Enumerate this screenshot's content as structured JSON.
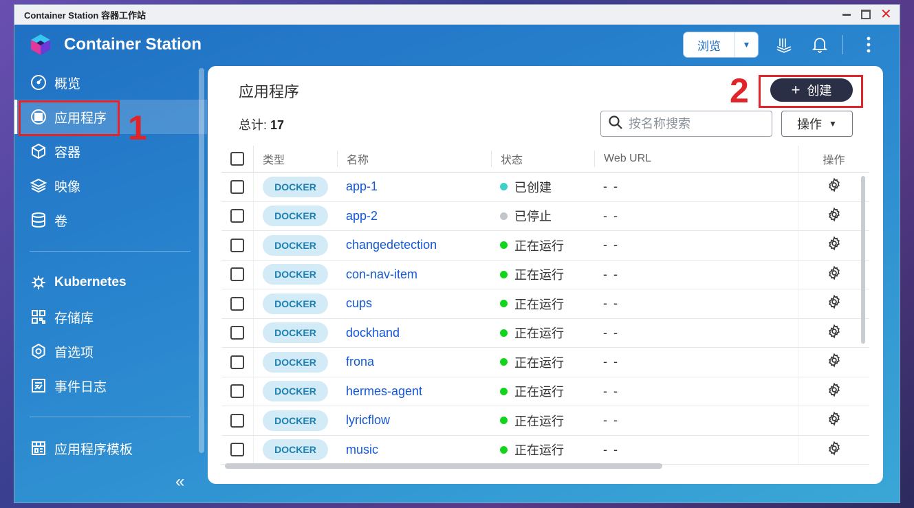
{
  "window": {
    "title": "Container Station 容器工作站"
  },
  "header": {
    "app_name": "Container Station",
    "browse_label": "浏览"
  },
  "sidebar": {
    "items": [
      {
        "label": "概览",
        "icon": "dashboard-icon"
      },
      {
        "label": "应用程序",
        "icon": "apps-grid-icon",
        "active": true
      },
      {
        "label": "容器",
        "icon": "cube-icon"
      },
      {
        "label": "映像",
        "icon": "layers-icon"
      },
      {
        "label": "卷",
        "icon": "database-icon"
      }
    ],
    "items2": [
      {
        "label": "Kubernetes",
        "icon": "helm-wheel-icon"
      },
      {
        "label": "存储库",
        "icon": "registry-icon"
      },
      {
        "label": "首选项",
        "icon": "settings-gear-icon"
      },
      {
        "label": "事件日志",
        "icon": "event-log-icon"
      }
    ],
    "items3": [
      {
        "label": "应用程序模板",
        "icon": "template-icon"
      }
    ],
    "collapse_glyph": "«"
  },
  "main": {
    "title": "应用程序",
    "total_label": "总计:",
    "total_value": "17",
    "create_label": "创建",
    "search_placeholder": "按名称搜索",
    "ops_label": "操作",
    "columns": {
      "type": "类型",
      "name": "名称",
      "status": "状态",
      "url": "Web URL",
      "action": "操作"
    },
    "rows": [
      {
        "type": "DOCKER",
        "name": "app-1",
        "status": "已创建",
        "status_color": "#3bd0c8",
        "url": "- -"
      },
      {
        "type": "DOCKER",
        "name": "app-2",
        "status": "已停止",
        "status_color": "#c2c5c9",
        "url": "- -"
      },
      {
        "type": "DOCKER",
        "name": "changedetection",
        "status": "正在运行",
        "status_color": "#12d41b",
        "url": "- -"
      },
      {
        "type": "DOCKER",
        "name": "con-nav-item",
        "status": "正在运行",
        "status_color": "#12d41b",
        "url": "- -"
      },
      {
        "type": "DOCKER",
        "name": "cups",
        "status": "正在运行",
        "status_color": "#12d41b",
        "url": "- -"
      },
      {
        "type": "DOCKER",
        "name": "dockhand",
        "status": "正在运行",
        "status_color": "#12d41b",
        "url": "- -"
      },
      {
        "type": "DOCKER",
        "name": "frona",
        "status": "正在运行",
        "status_color": "#12d41b",
        "url": "- -"
      },
      {
        "type": "DOCKER",
        "name": "hermes-agent",
        "status": "正在运行",
        "status_color": "#12d41b",
        "url": "- -"
      },
      {
        "type": "DOCKER",
        "name": "lyricflow",
        "status": "正在运行",
        "status_color": "#12d41b",
        "url": "- -"
      },
      {
        "type": "DOCKER",
        "name": "music",
        "status": "正在运行",
        "status_color": "#12d41b",
        "url": "- -"
      }
    ]
  },
  "annotations": {
    "step1": "1",
    "step2": "2",
    "color": "#e0242a"
  }
}
